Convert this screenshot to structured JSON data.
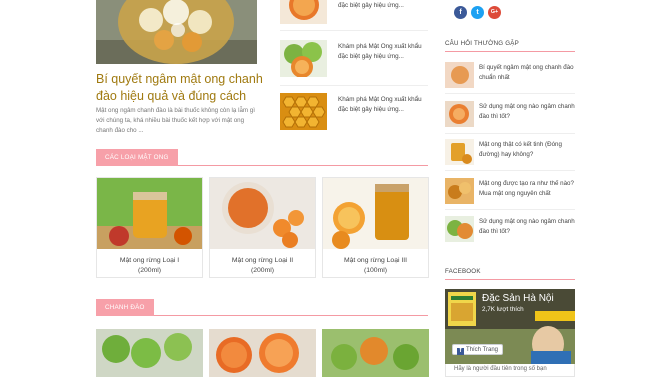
{
  "featured": {
    "title": "Bí quyết ngâm mật ong chanh đào hiệu quả và đúng cách",
    "excerpt": "Mật ong ngâm chanh đào là bài thuốc không còn lạ lẫm gì với chúng ta, khá nhiều bài thuốc kết hợp với mật ong chanh đào cho ..."
  },
  "mini_list": [
    {
      "text": "đặc biệt gây hiệu ứng..."
    },
    {
      "text": "Khám phá Mật Ong xuất khẩu đặc biệt gây hiệu ứng..."
    },
    {
      "text": "Khám phá Mật Ong xuất khẩu đặc biệt gây hiệu ứng..."
    }
  ],
  "sections": {
    "honey": "CÁC LOẠI MẬT ONG",
    "lemon": "CHANH ĐÀO"
  },
  "products": [
    {
      "line1": "Mật ong rừng Loại I",
      "line2": "(200ml)"
    },
    {
      "line1": "Mật ong rừng Loại II",
      "line2": "(200ml)"
    },
    {
      "line1": "Mật ong rừng Loại III",
      "line2": "(100ml)"
    }
  ],
  "social": {
    "facebook": "f",
    "twitter": "t",
    "google": "G+"
  },
  "sidebar": {
    "faq_title": "CÂU HỎI THƯỜNG GẶP",
    "faq": [
      {
        "text": "Bí quyết ngâm mật ong chanh đào chuẩn nhất"
      },
      {
        "text": "Sử dụng mật ong nào ngâm chanh đào thì tốt?"
      },
      {
        "text": "Mật ong thật có kết tinh (Đóng đường) hay không?"
      },
      {
        "text": "Mật ong được tạo ra như thế nào? Mua mật ong nguyên chất"
      },
      {
        "text": "Sử dụng mật ong nào ngâm chanh đào thì tốt?"
      }
    ],
    "facebook_title": "FACEBOOK",
    "fb": {
      "page_name": "Đặc Sản Hà Nội",
      "likes": "2,7K lượt thích",
      "like_button": "Thích Trang",
      "footer": "Hãy là người đầu tiên trong số bạn"
    }
  },
  "colors": {
    "accent": "#f7a0a9",
    "title": "#a07a10"
  }
}
